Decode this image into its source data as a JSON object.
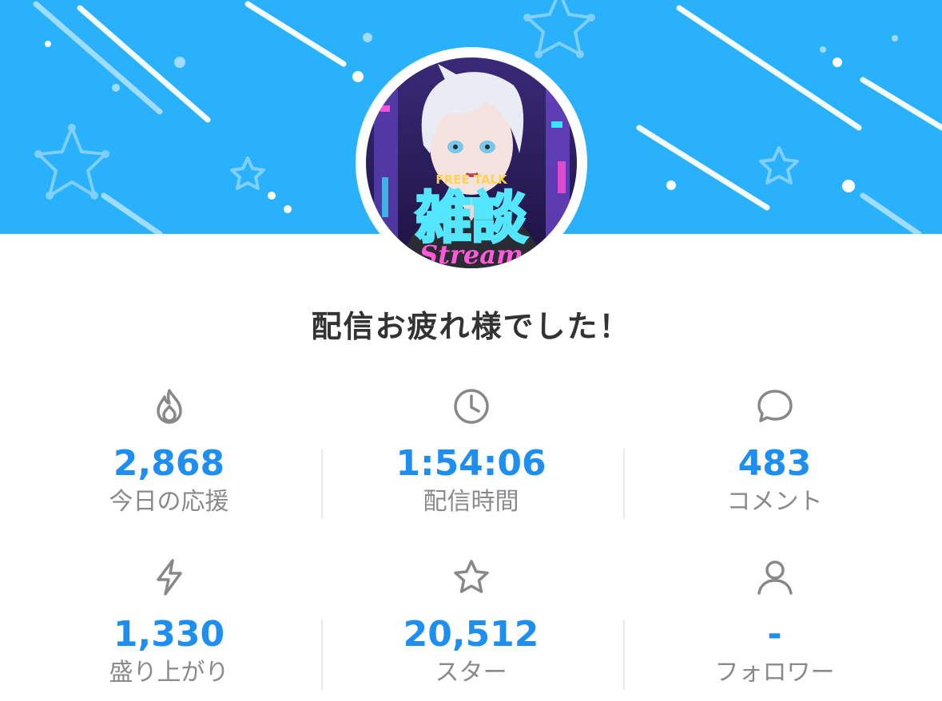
{
  "colors": {
    "banner": "#29b1fb",
    "accent": "#1f8ef1",
    "label": "#8a8a8a",
    "title": "#333333"
  },
  "avatar": {
    "neon_top": "FREE TALK",
    "neon_main": "雑談",
    "neon_bottom": "Stream"
  },
  "title": "配信お疲れ様でした！",
  "stats": [
    {
      "icon": "flame-icon",
      "value": "2,868",
      "label": "今日の応援"
    },
    {
      "icon": "clock-icon",
      "value": "1:54:06",
      "label": "配信時間"
    },
    {
      "icon": "chat-bubble-icon",
      "value": "483",
      "label": "コメント"
    },
    {
      "icon": "lightning-icon",
      "value": "1,330",
      "label": "盛り上がり"
    },
    {
      "icon": "star-icon",
      "value": "20,512",
      "label": "スター"
    },
    {
      "icon": "person-icon",
      "value": "-",
      "label": "フォロワー"
    }
  ]
}
